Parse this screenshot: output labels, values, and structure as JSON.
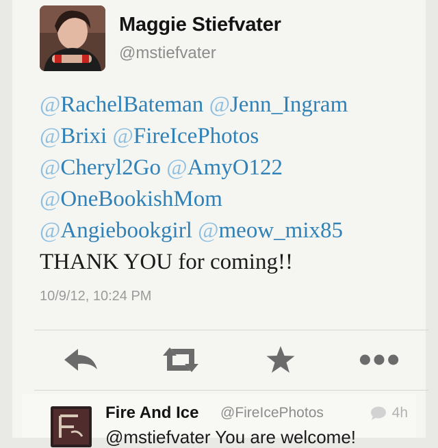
{
  "tweet": {
    "author_name": "Maggie Stiefvater",
    "author_handle": "@mstiefvater",
    "lines": [
      [
        {
          "t": "@",
          "c": "at"
        },
        {
          "t": "RachelBateman",
          "c": "mention"
        },
        {
          "t": " ",
          "c": "text"
        },
        {
          "t": "@",
          "c": "at"
        },
        {
          "t": "Jenn_Ingram",
          "c": "mention"
        }
      ],
      [
        {
          "t": "@",
          "c": "at"
        },
        {
          "t": "Brixi",
          "c": "mention"
        },
        {
          "t": " ",
          "c": "text"
        },
        {
          "t": "@",
          "c": "at"
        },
        {
          "t": "FireIcePhotos",
          "c": "mention"
        }
      ],
      [
        {
          "t": "@",
          "c": "at"
        },
        {
          "t": "Cheryl2Go",
          "c": "mention"
        },
        {
          "t": " ",
          "c": "text"
        },
        {
          "t": "@",
          "c": "at"
        },
        {
          "t": "AmyO122",
          "c": "mention"
        }
      ],
      [
        {
          "t": "@",
          "c": "at"
        },
        {
          "t": "OneBookishMom",
          "c": "mention"
        }
      ],
      [
        {
          "t": "@",
          "c": "at"
        },
        {
          "t": "Angiebookgirl",
          "c": "mention"
        },
        {
          "t": " ",
          "c": "text"
        },
        {
          "t": "@",
          "c": "at"
        },
        {
          "t": "meow_mix85",
          "c": "mention"
        }
      ],
      [
        {
          "t": "THANK YOU for coming!!",
          "c": "text"
        }
      ]
    ],
    "timestamp": "10/9/12, 10:24 PM"
  },
  "actions": [
    {
      "name": "reply",
      "icon": "reply-icon"
    },
    {
      "name": "retweet",
      "icon": "retweet-icon"
    },
    {
      "name": "favorite",
      "icon": "star-icon"
    },
    {
      "name": "more",
      "icon": "more-icon"
    }
  ],
  "reply": {
    "author_name": "Fire And Ice",
    "author_handle": "@FireIcePhotos",
    "time": "4h",
    "text": "@mstiefvater You are welcome!"
  },
  "colors": {
    "mention": "#2f81b7",
    "at_sign": "#8fbfe0",
    "icon_gray": "#6b6b6b",
    "background": "#f5f5f1"
  }
}
